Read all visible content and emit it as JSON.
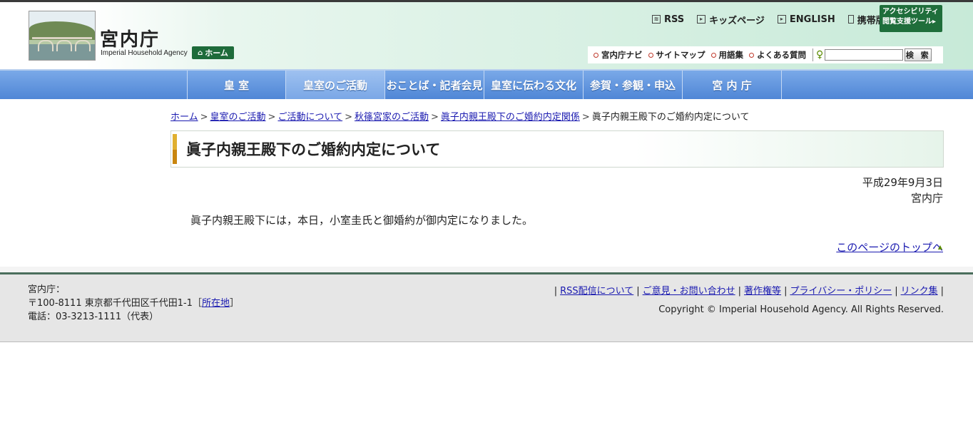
{
  "header": {
    "site_title": "宮内庁",
    "site_subtitle": "Imperial Household Agency",
    "home_button": "ホーム",
    "top_links": [
      "RSS",
      "キッズページ",
      "ENGLISH",
      "携帯版"
    ],
    "access_tool_line1": "アクセシビリティ",
    "access_tool_line2": "閲覧支援ツール",
    "sub_links": [
      "宮内庁ナビ",
      "サイトマップ",
      "用語集",
      "よくある質問"
    ],
    "search_placeholder": "",
    "search_button": "検 索"
  },
  "global_nav": [
    "皇 室",
    "皇室のご活動",
    "おことば・記者会見",
    "皇室に伝わる文化",
    "参賀・参観・申込",
    "宮 内 庁"
  ],
  "breadcrumb": {
    "links": [
      "ホーム",
      "皇室のご活動",
      "ご活動について",
      "秋篠宮家のご活動",
      "眞子内親王殿下のご婚約内定関係"
    ],
    "current": "眞子内親王殿下のご婚約内定について",
    "separator": ">"
  },
  "article": {
    "title": "眞子内親王殿下のご婚約内定について",
    "date": "平成29年9月3日",
    "issuer": "宮内庁",
    "body": "眞子内親王殿下には，本日，小室圭氏と御婚約が御内定になりました。",
    "to_top": "このページのトップへ"
  },
  "footer": {
    "org": "宮内庁：",
    "address": "〒100-8111 東京都千代田区千代田1-1［",
    "address_link": "所在地",
    "address_close": "］",
    "phone": "電話：03-3213-1111（代表）",
    "links": [
      "RSS配信について",
      "ご意見・お問い合わせ",
      "著作権等",
      "プライバシー・ポリシー",
      "リンク集"
    ],
    "copyright": "Copyright © Imperial Household Agency. All Rights Reserved."
  },
  "colors": {
    "accent_green": "#1e6b3a",
    "nav_blue": "#4f86d6",
    "link_blue": "#1a1ab0",
    "heading_gold": "#e0b030"
  }
}
